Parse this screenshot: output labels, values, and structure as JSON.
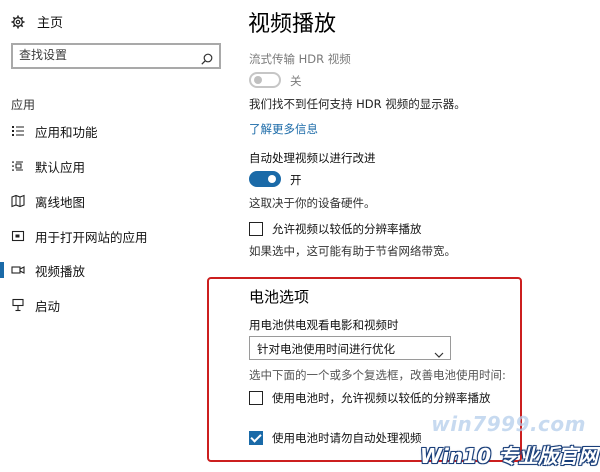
{
  "sidebar": {
    "home_label": "主页",
    "search_placeholder": "查找设置",
    "section_label": "应用",
    "items": [
      {
        "label": "应用和功能",
        "icon": "list-icon"
      },
      {
        "label": "默认应用",
        "icon": "default-apps-icon"
      },
      {
        "label": "离线地图",
        "icon": "map-icon"
      },
      {
        "label": "用于打开网站的应用",
        "icon": "open-web-icon"
      },
      {
        "label": "视频播放",
        "icon": "video-icon",
        "active": true
      },
      {
        "label": "启动",
        "icon": "startup-icon"
      }
    ]
  },
  "main": {
    "title": "视频播放",
    "hdr_label": "流式传输 HDR 视频",
    "hdr_state": "关",
    "hdr_note": "我们找不到任何支持 HDR 视频的显示器。",
    "learn_more": "了解更多信息",
    "auto_process_label": "自动处理视频以进行改进",
    "auto_process_state": "开",
    "auto_process_note": "这取决于你的设备硬件。",
    "low_res_checkbox": "允许视频以较低的分辨率播放",
    "low_res_note": "如果选中，这可能有助于节省网络带宽。",
    "battery": {
      "heading": "电池选项",
      "dropdown_label": "用电池供电观看电影和视频时",
      "dropdown_value": "针对电池使用时间进行优化",
      "hint": "选中下面的一个或多个复选框，改善电池使用时间:",
      "checkbox1": "使用电池时，允许视频以较低的分辨率播放",
      "checkbox1_checked": false,
      "checkbox2": "使用电池时请勿自动处理视频",
      "checkbox2_checked": true
    }
  },
  "watermark": {
    "site": "win7999.com",
    "logo_text": "Win10 专业版官网"
  },
  "colors": {
    "accent": "#1a6aa8",
    "highlight_border": "#cc1f1f"
  }
}
